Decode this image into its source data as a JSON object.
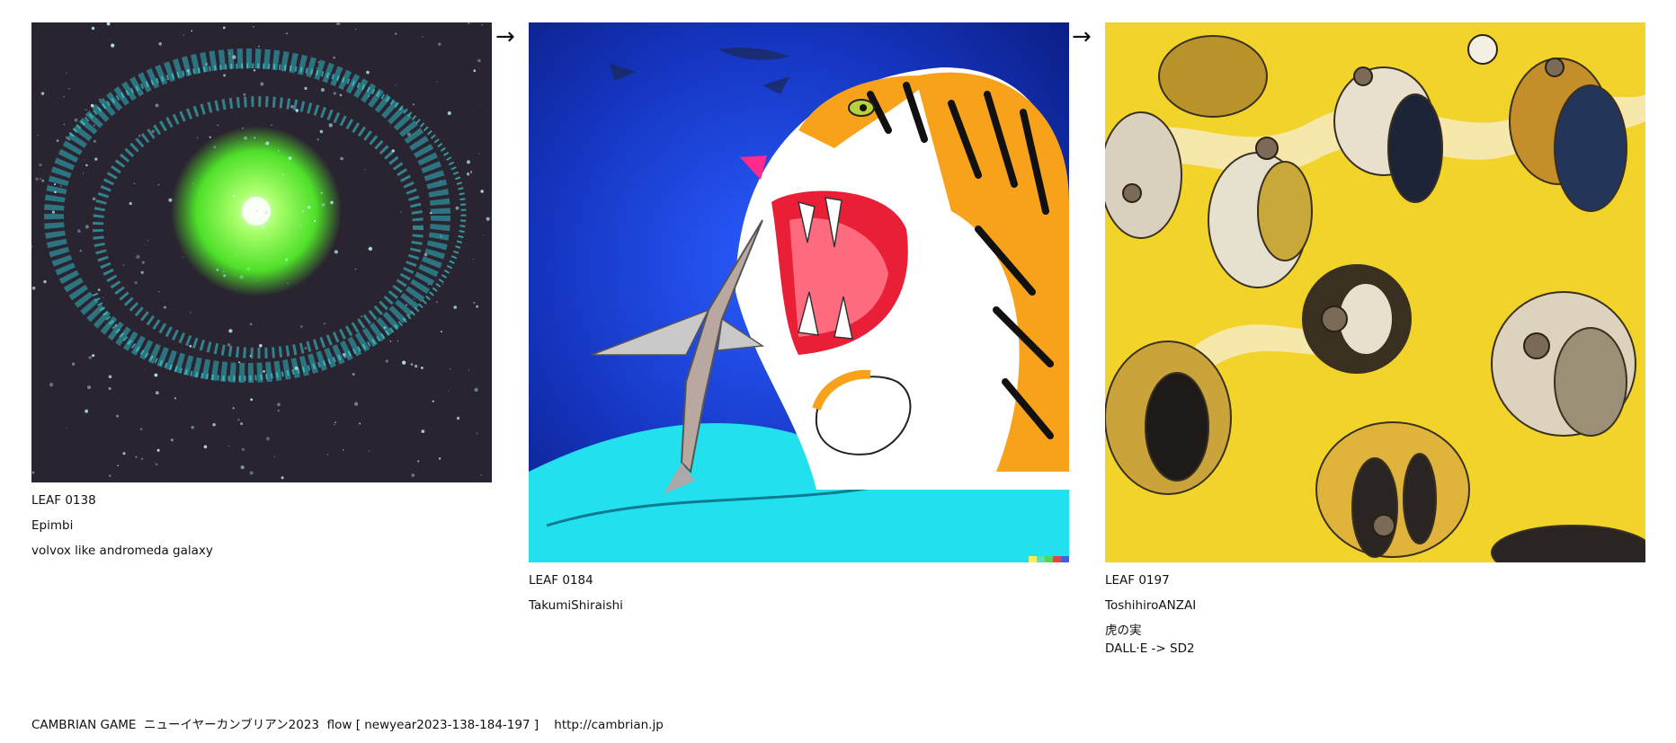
{
  "leaves": [
    {
      "id": "LEAF 0138",
      "author": "Epimbi",
      "title_lines": [
        "volvox like andromeda galaxy"
      ]
    },
    {
      "id": "LEAF 0184",
      "author": "TakumiShiraishi",
      "title_lines": []
    },
    {
      "id": "LEAF 0197",
      "author": "ToshihiroANZAI",
      "title_lines": [
        "虎の実",
        "DALL·E -> SD2"
      ]
    }
  ],
  "arrow_glyph": "→",
  "footer": "CAMBRIAN GAME  ニューイヤーカンブリアン2023  flow [ newyear2023-138-184-197 ]    http://cambrian.jp",
  "colors": {
    "galaxy_bg": "#2a2430",
    "galaxy_core": "#6cff3a",
    "galaxy_arms": "#3fd6d6",
    "tiger_bg": "#1430a8",
    "tiger_orange": "#f7a21a",
    "tiger_cyan": "#22e0ee",
    "yellow_bg": "#f1d32a"
  }
}
